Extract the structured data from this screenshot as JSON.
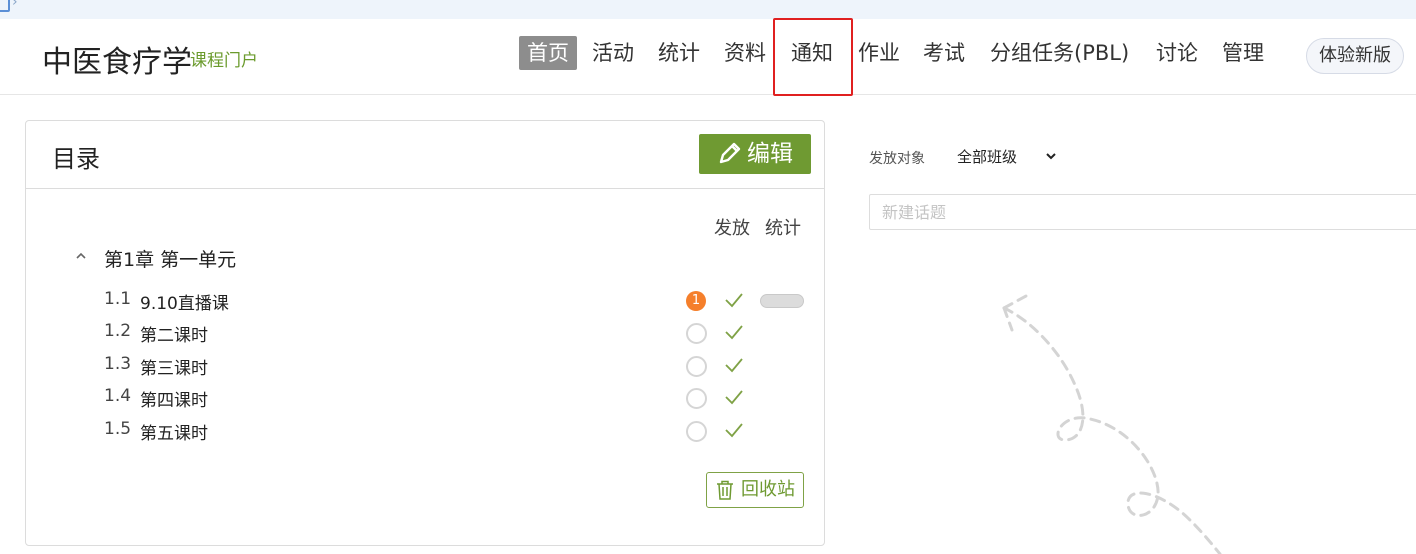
{
  "header": {
    "course_title": "中医食疗学",
    "course_subtitle": "课程门户",
    "nav": [
      {
        "label": "首页",
        "active": true
      },
      {
        "label": "活动"
      },
      {
        "label": "统计"
      },
      {
        "label": "资料"
      },
      {
        "label": "通知",
        "highlighted": true
      },
      {
        "label": "作业"
      },
      {
        "label": "考试"
      },
      {
        "label": "分组任务(PBL)"
      },
      {
        "label": "讨论"
      },
      {
        "label": "管理"
      }
    ],
    "new_version_label": "体验新版"
  },
  "catalog": {
    "title": "目录",
    "edit_label": "编辑",
    "col_release": "发放",
    "col_stats": "统计",
    "chapter": {
      "label": "第1章 第一单元"
    },
    "lessons": [
      {
        "num": "1.1",
        "name": "9.10直播课",
        "badge": "1"
      },
      {
        "num": "1.2",
        "name": "第二课时"
      },
      {
        "num": "1.3",
        "name": "第三课时"
      },
      {
        "num": "1.4",
        "name": "第四课时"
      },
      {
        "num": "1.5",
        "name": "第五课时"
      }
    ],
    "recycle_label": "回收站"
  },
  "right": {
    "audience_label": "发放对象",
    "audience_value": "全部班级",
    "topic_placeholder": "新建话题"
  },
  "colors": {
    "accent_green": "#6f9a32",
    "active_nav_bg": "#8d8d8d",
    "badge_orange": "#f57f2b",
    "highlight_red": "#e02020"
  }
}
